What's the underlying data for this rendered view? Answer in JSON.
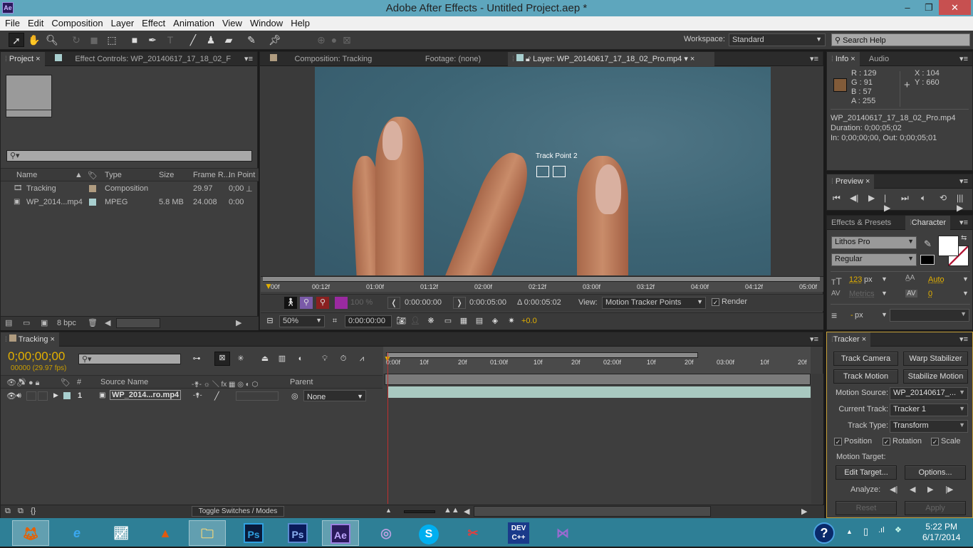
{
  "window": {
    "title": "Adobe After Effects - Untitled Project.aep *",
    "app_badge": "Ae",
    "minimize": "–",
    "restore": "❐",
    "close": "✕"
  },
  "menu": [
    "File",
    "Edit",
    "Composition",
    "Layer",
    "Effect",
    "Animation",
    "View",
    "Window",
    "Help"
  ],
  "toolbar": {
    "workspace_label": "Workspace:",
    "workspace_value": "Standard",
    "search_placeholder": "Search Help"
  },
  "project_panel": {
    "tabs": [
      "Project",
      "Effect Controls: WP_20140617_17_18_02_F"
    ],
    "search_placeholder": "",
    "columns": [
      "Name",
      "Type",
      "Size",
      "Frame R...",
      "In Point"
    ],
    "items": [
      {
        "name": "Tracking",
        "label_color": "#b09c80",
        "type": "Composition",
        "size": "",
        "frame_rate": "29.97",
        "in_point": "0;00"
      },
      {
        "name": "WP_2014...mp4",
        "label_color": "#a8cfcf",
        "type": "MPEG",
        "size": "5.8 MB",
        "frame_rate": "24.008",
        "in_point": "0:00"
      }
    ],
    "bpc": "8 bpc"
  },
  "viewer": {
    "tabs": [
      "Composition: Tracking",
      "Footage: (none)",
      "Layer: WP_20140617_17_18_02_Pro.mp4"
    ],
    "track_point_label": "Track Point 2",
    "ruler_ticks": [
      "00f",
      "00:12f",
      "01:00f",
      "01:12f",
      "02:00f",
      "02:12f",
      "03:00f",
      "03:12f",
      "04:00f",
      "04:12f",
      "05:00f"
    ],
    "opacity": "100 %",
    "in_time": "0:00:00:00",
    "out_time": "0:00:05:00",
    "duration": "Δ 0:00:05:02",
    "view_label": "View:",
    "view_value": "Motion Tracker Points",
    "render_label": "Render",
    "render_checked": true,
    "zoom": "50%",
    "current_time": "0:00:00:00",
    "exposure": "+0.0"
  },
  "info_panel": {
    "tabs": [
      "Info",
      "Audio"
    ],
    "swatch": "#815b39",
    "r": "R : 129",
    "g": "G : 91",
    "b": "B : 57",
    "a": "A : 255",
    "x": "X : 104",
    "y": "Y : 660",
    "file": "WP_20140617_17_18_02_Pro.mp4",
    "duration": "Duration: 0;00;05;02",
    "inout": "In: 0;00;00;00, Out: 0;00;05;01"
  },
  "preview_panel": {
    "tab": "Preview"
  },
  "character_panel": {
    "tabs": [
      "Effects & Presets",
      "Character"
    ],
    "font": "Lithos Pro",
    "style": "Regular",
    "size": "123",
    "size_unit": "px",
    "leading": "Auto",
    "kerning": "Metrics",
    "tracking": "0",
    "stroke": "-",
    "stroke_unit": "px"
  },
  "timeline": {
    "tab": "Tracking",
    "timecode": "0;00;00;00",
    "frames": "00000 (29.97 fps)",
    "columns": {
      "num": "#",
      "source": "Source Name",
      "parent": "Parent"
    },
    "layer": {
      "index": "1",
      "name": "WP_2014...ro.mp4",
      "parent": "None",
      "label_color": "#a8cfcf"
    },
    "ruler_ticks": [
      "0:00f",
      "10f",
      "20f",
      "01:00f",
      "10f",
      "20f",
      "02:00f",
      "10f",
      "20f",
      "03:00f",
      "10f",
      "20f"
    ],
    "toggle_label": "Toggle Switches / Modes"
  },
  "tracker": {
    "tab": "Tracker",
    "buttons": {
      "track_camera": "Track Camera",
      "warp_stabilizer": "Warp Stabilizer",
      "track_motion": "Track Motion",
      "stabilize_motion": "Stabilize Motion",
      "edit_target": "Edit Target...",
      "options": "Options...",
      "reset": "Reset",
      "apply": "Apply"
    },
    "motion_source_label": "Motion Source:",
    "motion_source": "WP_20140617_...",
    "current_track_label": "Current Track:",
    "current_track": "Tracker 1",
    "track_type_label": "Track Type:",
    "track_type": "Transform",
    "position": "Position",
    "rotation": "Rotation",
    "scale": "Scale",
    "motion_target_label": "Motion Target:",
    "analyze_label": "Analyze:"
  },
  "taskbar": {
    "apps": [
      "Firefox",
      "Internet Explorer",
      "Resource Monitor",
      "MATLAB",
      "File Explorer",
      "Photoshop",
      "Photoshop",
      "After Effects",
      "BitTorrent",
      "Skype",
      "Snipping Tool",
      "Dev-C++",
      "Visual Studio"
    ],
    "time": "5:22 PM",
    "date": "6/17/2014"
  }
}
